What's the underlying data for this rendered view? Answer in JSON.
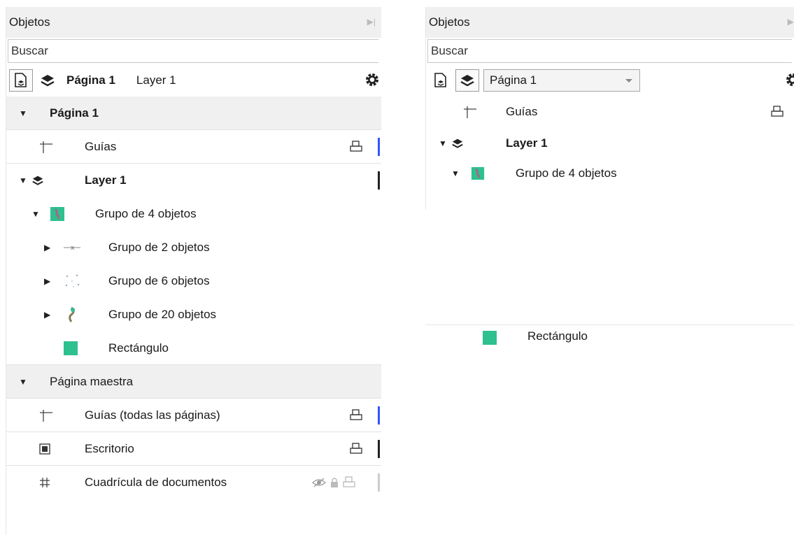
{
  "left": {
    "title": "Objetos",
    "search_placeholder": "Buscar",
    "toolbar": {
      "page": "Página 1",
      "layer": "Layer 1"
    },
    "rows": {
      "page1": "Página 1",
      "guides": "Guías",
      "layer1": "Layer 1",
      "group4": "Grupo de 4 objetos",
      "group2": "Grupo de 2 objetos",
      "group6": "Grupo de 6 objetos",
      "group20": "Grupo de 20 objetos",
      "rect": "Rectángulo",
      "master": "Página maestra",
      "guides_all": "Guías (todas las páginas)",
      "desktop": "Escritorio",
      "grid": "Cuadrícula de documentos"
    }
  },
  "right": {
    "title": "Objetos",
    "search_placeholder": "Buscar",
    "page_dropdown": "Página 1",
    "rows": {
      "guides": "Guías",
      "layer1": "Layer 1",
      "group4": "Grupo de 4 objetos",
      "rect": "Rectángulo"
    }
  },
  "colors": {
    "header_bg": "#f0f0f0",
    "rect_swatch": "#2ec08f",
    "guide_accent": "#3355ff"
  }
}
